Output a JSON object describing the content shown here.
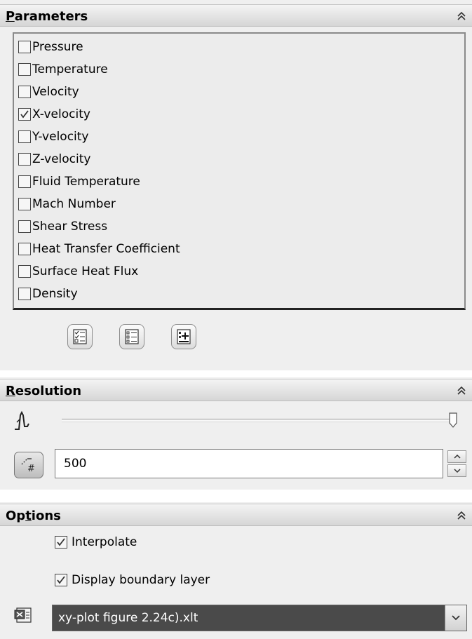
{
  "parameters": {
    "title_accel": "P",
    "title_rest": "arameters",
    "items": [
      {
        "label": "Pressure",
        "checked": false
      },
      {
        "label": "Temperature",
        "checked": false
      },
      {
        "label": "Velocity",
        "checked": false
      },
      {
        "label": "X-velocity",
        "checked": true
      },
      {
        "label": "Y-velocity",
        "checked": false
      },
      {
        "label": "Z-velocity",
        "checked": false
      },
      {
        "label": "Fluid Temperature",
        "checked": false
      },
      {
        "label": "Mach Number",
        "checked": false
      },
      {
        "label": "Shear Stress",
        "checked": false
      },
      {
        "label": "Heat Transfer Coefficient",
        "checked": false
      },
      {
        "label": "Surface Heat Flux",
        "checked": false
      },
      {
        "label": "Density",
        "checked": false
      }
    ]
  },
  "resolution": {
    "title_accel": "R",
    "title_rest": "esolution",
    "slider_value": 1.0,
    "value": "500"
  },
  "options": {
    "title_pre": "Op",
    "title_accel": "t",
    "title_rest": "ions",
    "interpolate_label": "Interpolate",
    "interpolate_checked": true,
    "boundary_label": "Display boundary layer",
    "boundary_checked": true,
    "template_value": "xy-plot figure 2.24c).xlt"
  },
  "icons": {
    "collapse": "double-chevron-up-icon",
    "resolution": "step-signal-icon",
    "number": "number-pencil-icon",
    "template": "excel-template-icon"
  }
}
